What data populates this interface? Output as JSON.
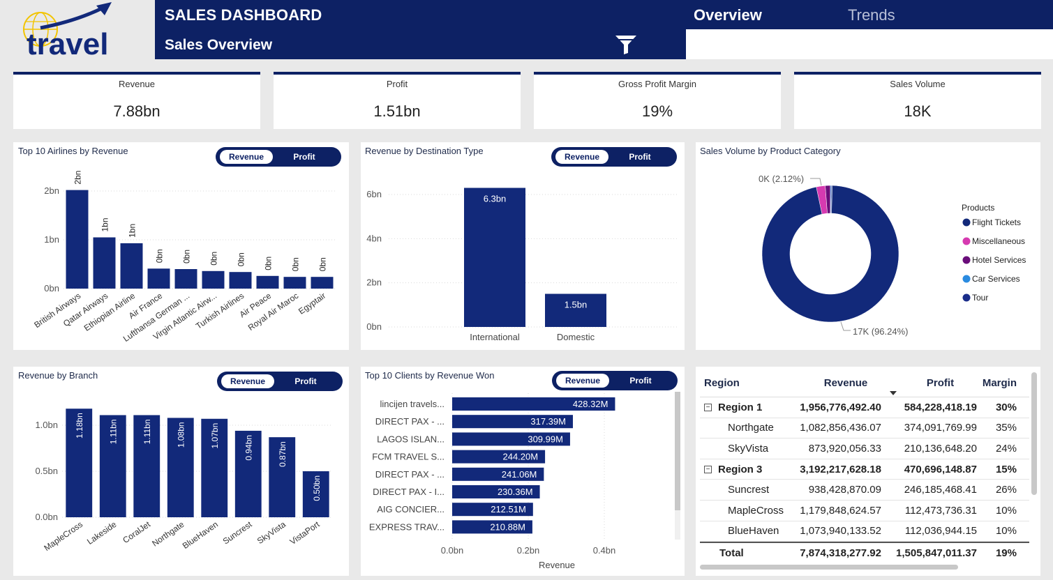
{
  "header": {
    "logo_text": "travel",
    "title": "SALES DASHBOARD",
    "subtitle": "Sales Overview",
    "tabs": [
      {
        "label": "Overview",
        "active": true
      },
      {
        "label": "Trends",
        "active": false
      }
    ]
  },
  "kpis": [
    {
      "label": "Revenue",
      "value": "7.88bn"
    },
    {
      "label": "Profit",
      "value": "1.51bn"
    },
    {
      "label": "Gross Profit Margin",
      "value": "19%"
    },
    {
      "label": "Sales Volume",
      "value": "18K"
    }
  ],
  "toggles": {
    "primary": "Revenue",
    "secondary": "Profit"
  },
  "colors": {
    "primary": "#0d2164",
    "bar": "#12297a",
    "pink": "#d63ab0",
    "purple": "#6a0d7a",
    "blue": "#2a8be0"
  },
  "panels": {
    "airlines_title": "Top 10 Airlines by Revenue",
    "destination_title": "Revenue by Destination Type",
    "product_title": "Sales Volume by Product Category",
    "branch_title": "Revenue by Branch",
    "clients_title": "Top 10 Clients by Revenue Won"
  },
  "chart_data": [
    {
      "id": "airlines",
      "type": "bar",
      "title": "Top 10 Airlines by Revenue",
      "categories": [
        "British Airways",
        "Qatar Airways",
        "Ethiopian Airline",
        "Air France",
        "Lufthansa German ...",
        "Virgin Atlantic Airw...",
        "Turkish Airlines",
        "Air Peace",
        "Royal Air Maroc",
        "Egyptair"
      ],
      "values": [
        2.02,
        1.05,
        0.93,
        0.41,
        0.4,
        0.36,
        0.34,
        0.26,
        0.24,
        0.24
      ],
      "labels": [
        "2bn",
        "1bn",
        "1bn",
        "0bn",
        "0bn",
        "0bn",
        "0bn",
        "0bn",
        "0bn",
        "0bn"
      ],
      "yticks": [
        "0bn",
        "1bn",
        "2bn"
      ],
      "ylim": [
        0,
        2.0
      ]
    },
    {
      "id": "destination",
      "type": "bar",
      "title": "Revenue by Destination Type",
      "categories": [
        "International",
        "Domestic"
      ],
      "values": [
        6.3,
        1.5
      ],
      "labels": [
        "6.3bn",
        "1.5bn"
      ],
      "yticks": [
        "0bn",
        "2bn",
        "4bn",
        "6bn"
      ],
      "ylim": [
        0,
        6
      ]
    },
    {
      "id": "product",
      "type": "pie",
      "title": "Sales Volume by Product Category",
      "legend_title": "Products",
      "categories": [
        "Flight Tickets",
        "Miscellaneous",
        "Hotel Services",
        "Car Services",
        "Tour"
      ],
      "values": [
        96.24,
        2.12,
        1.2,
        0.22,
        0.22
      ],
      "callouts": [
        "17K (96.24%)",
        "0K (2.12%)"
      ],
      "legend": "right"
    },
    {
      "id": "branch",
      "type": "bar",
      "title": "Revenue by Branch",
      "categories": [
        "MapleCross",
        "Lakeside",
        "CoralJet",
        "Northgate",
        "BlueHaven",
        "Suncrest",
        "SkyVista",
        "VistaPort"
      ],
      "values": [
        1.18,
        1.11,
        1.11,
        1.08,
        1.07,
        0.94,
        0.87,
        0.5
      ],
      "labels": [
        "1.18bn",
        "1.11bn",
        "1.11bn",
        "1.08bn",
        "1.07bn",
        "0.94bn",
        "0.87bn",
        "0.50bn"
      ],
      "yticks": [
        "0.0bn",
        "0.5bn",
        "1.0bn"
      ],
      "ylim": [
        0,
        1.0
      ]
    },
    {
      "id": "clients",
      "type": "bar",
      "orientation": "horizontal",
      "title": "Top 10 Clients by Revenue Won",
      "categories": [
        "lincijen travels...",
        "DIRECT PAX - ...",
        "LAGOS ISLAN...",
        "FCM TRAVEL S...",
        "DIRECT PAX - ...",
        "DIRECT PAX - I...",
        "AIG CONCIER...",
        "EXPRESS TRAV..."
      ],
      "values": [
        428.32,
        317.39,
        309.99,
        244.2,
        241.06,
        230.36,
        212.51,
        210.88
      ],
      "labels": [
        "428.32M",
        "317.39M",
        "309.99M",
        "244.20M",
        "241.06M",
        "230.36M",
        "212.51M",
        "210.88M"
      ],
      "xticks": [
        "0.0bn",
        "0.2bn",
        "0.4bn"
      ],
      "xlabel": "Revenue",
      "xlim": [
        0,
        0.4
      ]
    }
  ],
  "table": {
    "headers": [
      "Region",
      "Revenue",
      "Profit",
      "Margin"
    ],
    "rows": [
      {
        "name": "Region 1",
        "revenue": "1,956,776,492.40",
        "profit": "584,228,418.19",
        "margin": "30%"
      },
      {
        "name": "Northgate",
        "revenue": "1,082,856,436.07",
        "profit": "374,091,769.99",
        "margin": "35%"
      },
      {
        "name": "SkyVista",
        "revenue": "873,920,056.33",
        "profit": "210,136,648.20",
        "margin": "24%"
      },
      {
        "name": "Region 3",
        "revenue": "3,192,217,628.18",
        "profit": "470,696,148.87",
        "margin": "15%"
      },
      {
        "name": "Suncrest",
        "revenue": "938,428,870.09",
        "profit": "246,185,468.41",
        "margin": "26%"
      },
      {
        "name": "MapleCross",
        "revenue": "1,179,848,624.57",
        "profit": "112,473,736.31",
        "margin": "10%"
      },
      {
        "name": "BlueHaven",
        "revenue": "1,073,940,133.52",
        "profit": "112,036,944.15",
        "margin": "10%"
      }
    ],
    "total": {
      "name": "Total",
      "revenue": "7,874,318,277.92",
      "profit": "1,505,847,011.37",
      "margin": "19%"
    },
    "expand_symbol": "⊟"
  }
}
